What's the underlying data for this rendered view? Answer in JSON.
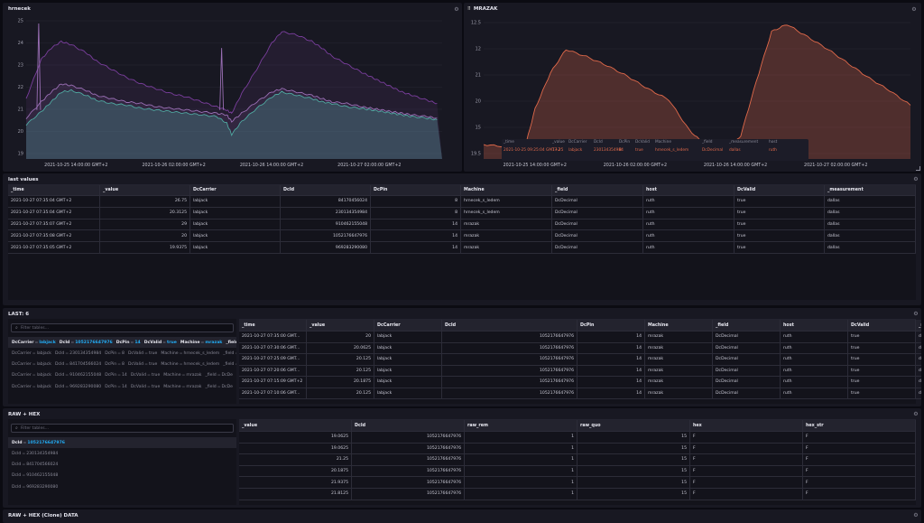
{
  "panels": {
    "hrnecek": {
      "title": "hrnecek"
    },
    "mrazak": {
      "title": "MRAZAK"
    },
    "last_values": {
      "title": "last values"
    },
    "last6": {
      "title": "LAST: 6"
    },
    "raw_hex": {
      "title": "RAW + HEX"
    },
    "raw_hex_clone": {
      "title": "RAW + HEX (Clone) DATA"
    }
  },
  "chart_data": [
    {
      "type": "area",
      "title": "hrnecek",
      "ylim": [
        17.5,
        26.3
      ],
      "y_ticks": [
        "25",
        "24",
        "23",
        "22",
        "21",
        "20",
        "19"
      ],
      "x_ticks": [
        "2021-10-25 14:00:00 GMT+2",
        "2021-10-26 02:00:00 GMT+2",
        "2021-10-26 14:00:00 GMT+2",
        "2021-10-27 02:00:00 GMT+2"
      ],
      "series": [
        {
          "color": "#7a3e9d",
          "x": [
            0,
            0.3,
            0.5,
            0.7,
            0.9,
            1.2,
            1.4,
            1.7,
            2.0,
            2.3,
            2.6,
            2.9,
            3.2,
            3.5,
            3.8,
            4.0,
            4.1,
            4.3,
            4.6,
            4.9,
            5.1,
            5.4,
            5.7,
            5.9,
            6.1,
            6.4,
            6.7,
            6.9,
            7.1,
            7.3,
            7.5,
            7.7,
            8.0,
            8.2
          ],
          "values": [
            21.2,
            23.6,
            24.3,
            24.7,
            24.5,
            24.0,
            23.5,
            23.0,
            22.5,
            22.1,
            21.8,
            21.5,
            21.3,
            21.0,
            20.7,
            20.5,
            20.3,
            21.5,
            23.0,
            24.6,
            25.3,
            25.1,
            24.7,
            24.3,
            23.8,
            23.3,
            22.8,
            22.5,
            22.2,
            21.9,
            21.6,
            21.4,
            21.1,
            20.9
          ]
        },
        {
          "color": "#9a6fb5",
          "x": [
            0,
            0.3,
            0.5,
            0.7,
            0.9,
            1.2,
            1.4,
            1.7,
            2.0,
            2.3,
            2.6,
            2.9,
            3.2,
            3.5,
            3.8,
            4.0,
            4.1,
            4.3,
            4.6,
            4.9,
            5.1,
            5.4,
            5.7,
            5.9,
            6.1,
            6.4,
            6.7,
            6.9,
            7.1,
            7.3,
            7.5,
            7.7,
            8.0,
            8.2
          ],
          "values": [
            20.0,
            21.0,
            21.6,
            22.1,
            22.0,
            21.7,
            21.4,
            21.2,
            21.0,
            20.9,
            20.7,
            20.6,
            20.5,
            20.4,
            20.3,
            20.2,
            19.8,
            20.3,
            21.0,
            21.6,
            21.8,
            21.6,
            21.4,
            21.2,
            21.0,
            20.9,
            20.7,
            20.6,
            20.5,
            20.4,
            20.3,
            20.2,
            20.1,
            20.0
          ]
        },
        {
          "color": "#4fa8a0",
          "x": [
            0,
            0.3,
            0.5,
            0.7,
            0.9,
            1.2,
            1.4,
            1.7,
            2.0,
            2.3,
            2.6,
            2.9,
            3.2,
            3.5,
            3.8,
            4.0,
            4.1,
            4.3,
            4.6,
            4.9,
            5.1,
            5.4,
            5.7,
            5.9,
            6.1,
            6.4,
            6.7,
            6.9,
            7.1,
            7.3,
            7.5,
            7.7,
            8.0,
            8.2
          ],
          "values": [
            19.6,
            20.4,
            21.0,
            21.6,
            21.7,
            21.4,
            21.1,
            20.9,
            20.8,
            20.6,
            20.5,
            20.4,
            20.3,
            20.2,
            20.1,
            19.7,
            19.0,
            19.8,
            20.6,
            21.3,
            21.6,
            21.4,
            21.2,
            21.0,
            20.9,
            20.7,
            20.6,
            20.5,
            20.4,
            20.3,
            20.2,
            20.1,
            20.0,
            19.9
          ]
        }
      ],
      "spikes": [
        {
          "x": 0.25,
          "value": 25.8
        },
        {
          "x": 3.9,
          "value": 24.3
        }
      ]
    },
    {
      "type": "area",
      "title": "MRAZAK",
      "ylim": [
        18.7,
        26.6
      ],
      "y_ticks": [
        "12.5",
        "12",
        "21",
        "20",
        "15",
        "19.5"
      ],
      "x_ticks": [
        "2021-10-25 14:00:00 GMT+2",
        "2021-10-26 02:00:00 GMT+2",
        "2021-10-26 14:00:00 GMT+2",
        "2021-10-27 02:00:00 GMT+2"
      ],
      "series": [
        {
          "color": "#e0694a",
          "x": [
            0,
            0.4,
            0.8,
            1.0,
            1.3,
            1.6,
            2.0,
            2.4,
            2.8,
            3.2,
            3.6,
            4.0,
            4.3,
            4.6,
            4.8,
            5.0,
            5.3,
            5.6,
            5.9,
            6.3,
            6.7,
            7.1,
            7.5,
            7.9,
            8.3
          ],
          "values": [
            19.5,
            19.4,
            19.3,
            21.5,
            23.5,
            24.8,
            24.4,
            23.9,
            23.3,
            22.6,
            22.0,
            20.3,
            19.5,
            19.4,
            19.3,
            20.0,
            23.0,
            25.8,
            26.2,
            25.5,
            24.8,
            24.0,
            23.2,
            22.5,
            21.7
          ]
        }
      ],
      "hover": {
        "headers": [
          "_time",
          "_value",
          "DcCarrier",
          "DcId",
          "DcPin",
          "DcValid",
          "Machine",
          "_field",
          "_measurement",
          "host"
        ],
        "values": [
          "2021-10-25 09:25:04 GMT+2",
          "17.25",
          "labjack",
          "230134354984",
          "8",
          "true",
          "hrnecek_s_ledem",
          "DcDecimal",
          "dallas",
          "ruth"
        ]
      }
    }
  ],
  "last_values": {
    "columns": [
      "_time",
      "_value",
      "DcCarrier",
      "DcId",
      "DcPin",
      "Machine",
      "_field",
      "host",
      "DcValid",
      "_measurement"
    ],
    "rows": [
      [
        "2021-10-27 07:35:04 GMT+2",
        "26.75",
        "labjack",
        "84170456024",
        "8",
        "hrnecek_s_ledem",
        "DcDecimal",
        "ruth",
        "true",
        "dallas"
      ],
      [
        "2021-10-27 07:35:04 GMT+2",
        "20.3125",
        "labjack",
        "230134354984",
        "8",
        "hrnecek_s_ledem",
        "DcDecimal",
        "ruth",
        "true",
        "dallas"
      ],
      [
        "2021-10-27 07:35:07 GMT+2",
        "29",
        "labjack",
        "910462155048",
        "14",
        "mrazak",
        "DcDecimal",
        "ruth",
        "true",
        "dallas"
      ],
      [
        "2021-10-27 07:35:08 GMT+2",
        "20",
        "labjack",
        "1052176647976",
        "14",
        "mrazak",
        "DcDecimal",
        "ruth",
        "true",
        "dallas"
      ],
      [
        "2021-10-27 07:35:05 GMT+2",
        "19.9375",
        "labjack",
        "969283290080",
        "14",
        "mrazak",
        "DcDecimal",
        "ruth",
        "true",
        "dallas"
      ]
    ]
  },
  "last6": {
    "search_placeholder": "Filter tables...",
    "tags": [
      [
        [
          "DcCarrier",
          "labjack"
        ],
        [
          "DcId",
          "1052176647976"
        ],
        [
          "DcPin",
          "14"
        ],
        [
          "DcValid",
          "true"
        ],
        [
          "Machine",
          "mrazak"
        ],
        [
          "_field",
          "DcDe"
        ]
      ],
      [
        [
          "DcCarrier",
          "labjack"
        ],
        [
          "DcId",
          "230134354984"
        ],
        [
          "DcPin",
          "8"
        ],
        [
          "DcValid",
          "true"
        ],
        [
          "Machine",
          "hrnecek_s_ledem"
        ],
        [
          "_field",
          ""
        ]
      ],
      [
        [
          "DcCarrier",
          "labjack"
        ],
        [
          "DcId",
          "841704566024"
        ],
        [
          "DcPin",
          "8"
        ],
        [
          "DcValid",
          "true"
        ],
        [
          "Machine",
          "hrnecek_s_ledem"
        ],
        [
          "_field",
          ""
        ]
      ],
      [
        [
          "DcCarrier",
          "labjack"
        ],
        [
          "DcId",
          "910462155048"
        ],
        [
          "DcPin",
          "14"
        ],
        [
          "DcValid",
          "true"
        ],
        [
          "Machine",
          "mrazak"
        ],
        [
          "_field",
          "DcDe"
        ]
      ],
      [
        [
          "DcCarrier",
          "labjack"
        ],
        [
          "DcId",
          "969283290080"
        ],
        [
          "DcPin",
          "14"
        ],
        [
          "DcValid",
          "true"
        ],
        [
          "Machine",
          "mrazak"
        ],
        [
          "_field",
          "DcDe"
        ]
      ]
    ],
    "columns": [
      "_time",
      "_value",
      "DcCarrier",
      "DcId",
      "DcPin",
      "Machine",
      "_field",
      "host",
      "DcValid",
      "_measurement"
    ],
    "rows": [
      [
        "2021-10-27 07:35:00 GMT...",
        "20",
        "labjack",
        "1052176647976",
        "14",
        "mrazak",
        "DcDecimal",
        "ruth",
        "true",
        "dallas"
      ],
      [
        "2021-10-27 07:30:06 GMT...",
        "20.0625",
        "labjack",
        "1052176647976",
        "14",
        "mrazak",
        "DcDecimal",
        "ruth",
        "true",
        "dallas"
      ],
      [
        "2021-10-27 07:25:09 GMT...",
        "20.125",
        "labjack",
        "1052176647976",
        "14",
        "mrazak",
        "DcDecimal",
        "ruth",
        "true",
        "dallas"
      ],
      [
        "2021-10-27 07:20:06 GMT...",
        "20.125",
        "labjack",
        "1052176647976",
        "14",
        "mrazak",
        "DcDecimal",
        "ruth",
        "true",
        "dallas"
      ],
      [
        "2021-10-27 07:15:09 GMT+2",
        "20.1875",
        "labjack",
        "1052176647976",
        "14",
        "mrazak",
        "DcDecimal",
        "ruth",
        "true",
        "dallas"
      ],
      [
        "2021-10-27 07:10:06 GMT...",
        "20.125",
        "labjack",
        "1052176647976",
        "14",
        "mrazak",
        "DcDecimal",
        "ruth",
        "true",
        "dallas"
      ]
    ]
  },
  "raw_hex": {
    "search_placeholder": "Filter tables...",
    "tags": [
      [
        "DcId",
        "1052176647976"
      ],
      [
        "DcId",
        "230134354984"
      ],
      [
        "DcId",
        "841704566024"
      ],
      [
        "DcId",
        "910462155048"
      ],
      [
        "DcId",
        "969283290080"
      ]
    ],
    "columns": [
      "_value",
      "DcId",
      "raw_rem",
      "raw_quo",
      "hex",
      "hex_str"
    ],
    "rows": [
      [
        "19.0625",
        "1052176647976",
        "1",
        "15",
        "F",
        "F"
      ],
      [
        "19.0625",
        "1052176647976",
        "1",
        "15",
        "F",
        "F"
      ],
      [
        "21.25",
        "1052176647976",
        "1",
        "15",
        "F",
        "F"
      ],
      [
        "20.1875",
        "1052176647976",
        "1",
        "15",
        "F",
        "F"
      ],
      [
        "21.9375",
        "1052176647976",
        "1",
        "15",
        "F",
        "F"
      ],
      [
        "21.8125",
        "1052176647976",
        "1",
        "15",
        "F",
        "F"
      ]
    ]
  },
  "colors": {
    "bg": "#0b0b12",
    "panel": "#181822",
    "accent": "#22adf6",
    "hrnecek_top": "#7a3e9d",
    "hrnecek_mid": "#9a6fb5",
    "hrnecek_low": "#4fa8a0",
    "mrazak": "#e0694a"
  }
}
